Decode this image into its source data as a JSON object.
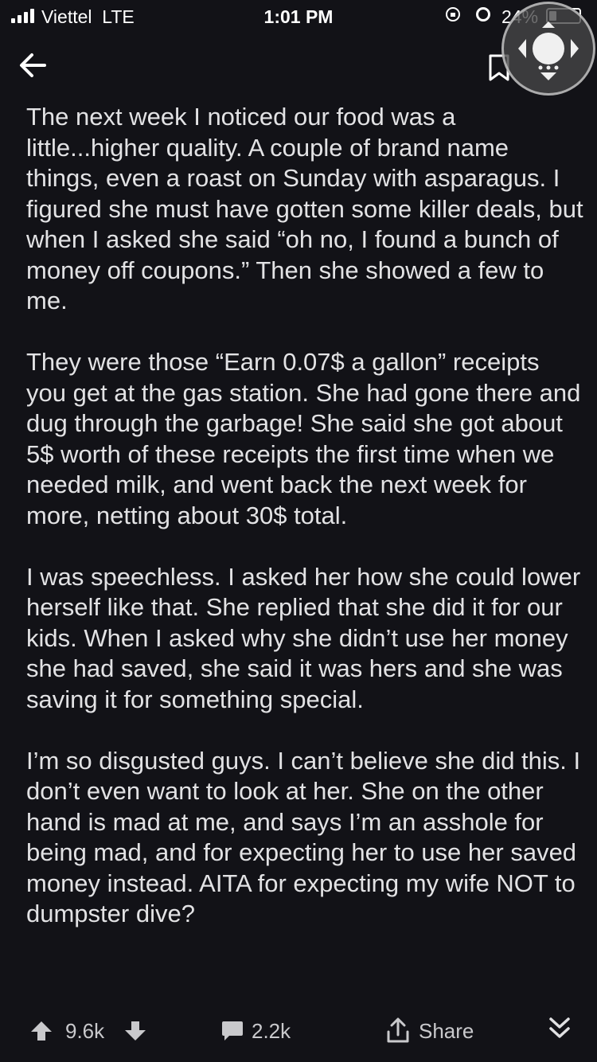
{
  "status_bar": {
    "carrier": "Viettel",
    "network": "LTE",
    "time": "1:01 PM",
    "battery": "24%"
  },
  "post": {
    "paragraphs": [
      "The next week I noticed our food was a little...higher quality. A couple of brand name things, even a roast on Sunday with asparagus. I figured she must have gotten some killer deals, but when I asked she said “oh no, I found a bunch of money off coupons.” Then she showed a few to me.",
      "They were those “Earn 0.07$ a gallon” receipts you get at the gas station. She had gone there and dug through the garbage! She said she got about 5$ worth of these receipts the first time when we needed milk, and went back the next week for more, netting about 30$ total.",
      "I was speechless. I asked her how she could lower herself like that. She replied that she did it for our kids. When I asked why she didn’t use her money she had saved, she said it was hers and she was saving it for something special.",
      "I’m so disgusted guys. I can’t believe she did this. I don’t even want to look at her. She on the other hand is mad at me, and says I’m an asshole for being mad, and for expecting her to use her saved money instead. AITA for expecting my wife NOT to dumpster dive?"
    ]
  },
  "actions": {
    "votes": "9.6k",
    "comments": "2.2k",
    "share_label": "Share"
  },
  "icons": {
    "back": "arrow-left-icon",
    "bookmark": "bookmark-icon",
    "assistive": "assistive-touch-icon",
    "upvote": "arrow-up-icon",
    "downvote": "arrow-down-icon",
    "comment": "comment-bubble-icon",
    "share": "share-icon",
    "collapse": "double-chevron-down-icon"
  }
}
